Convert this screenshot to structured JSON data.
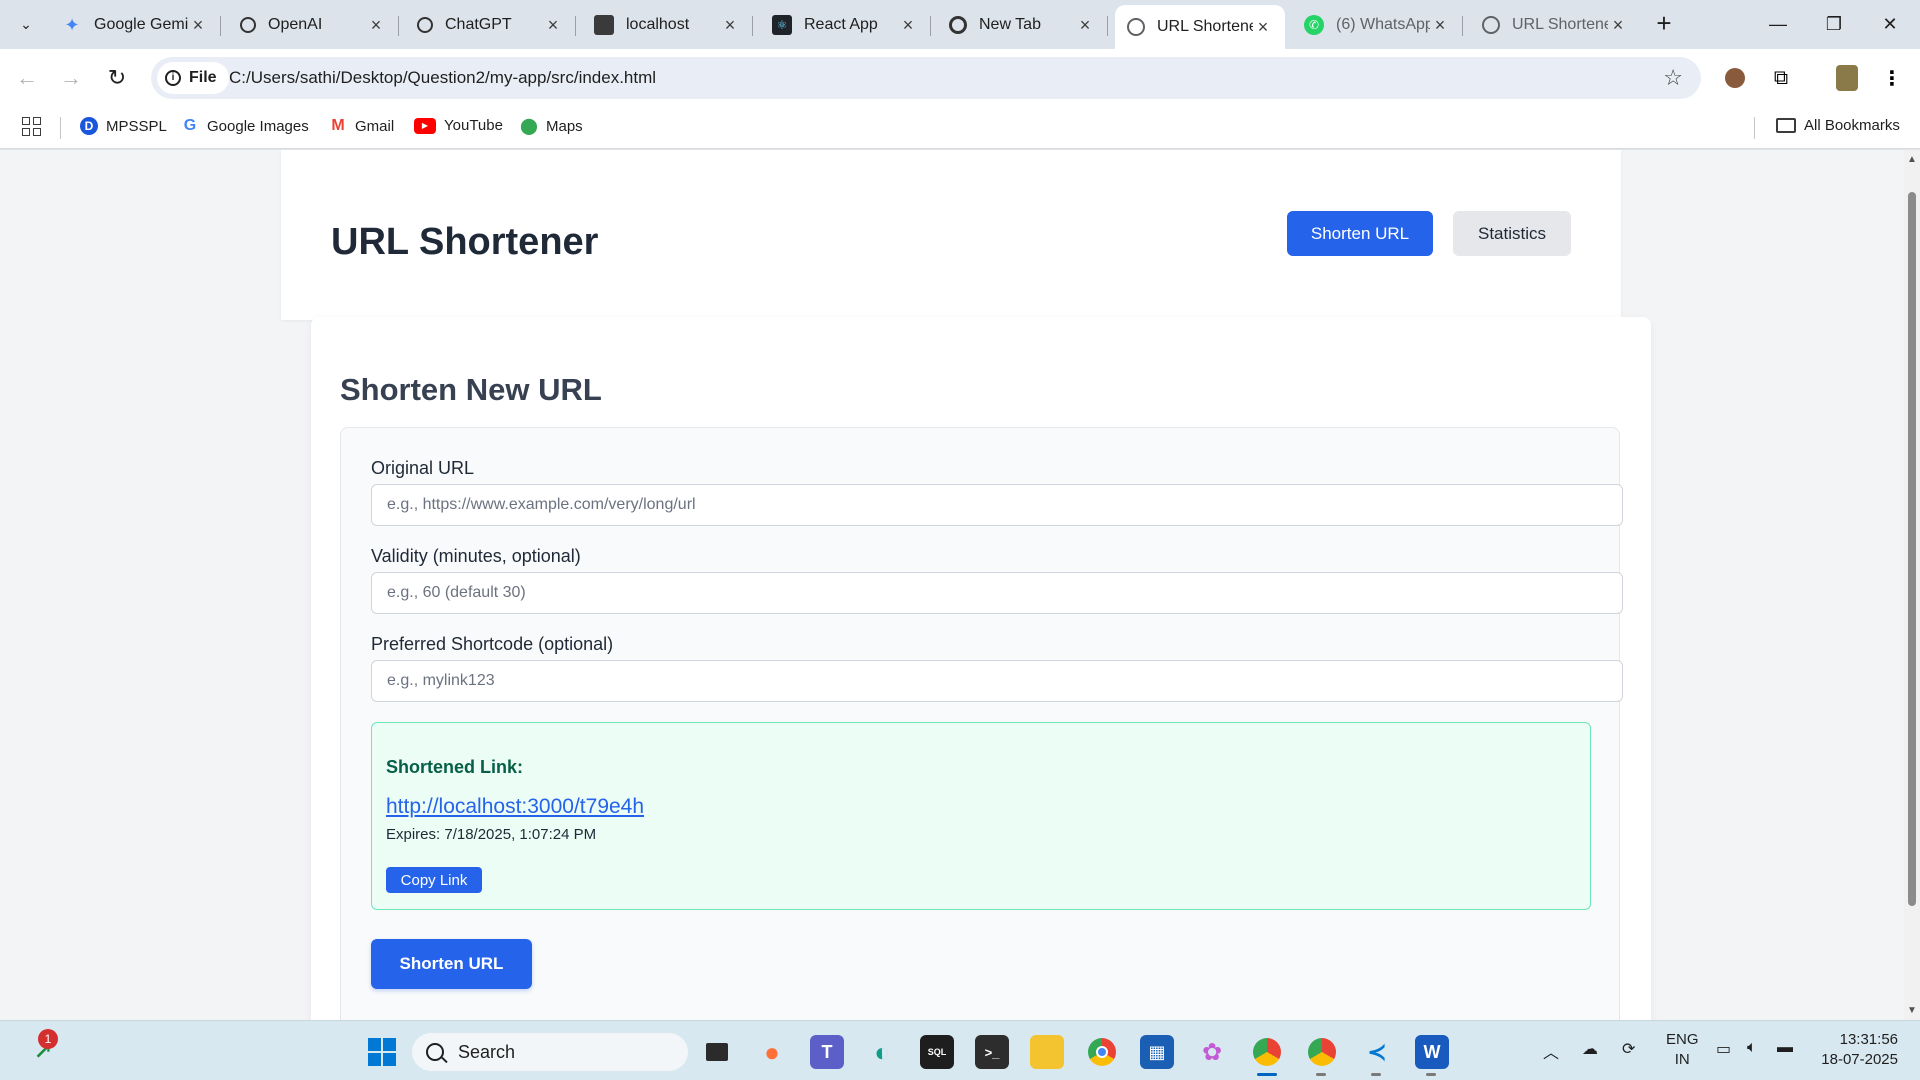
{
  "browser": {
    "tabs": [
      {
        "title": "Google Gemi",
        "active": false
      },
      {
        "title": "OpenAI",
        "active": false
      },
      {
        "title": "ChatGPT",
        "active": false
      },
      {
        "title": "localhost",
        "active": false
      },
      {
        "title": "React App",
        "active": false
      },
      {
        "title": "New Tab",
        "active": false
      },
      {
        "title": "URL Shortene",
        "active": true
      },
      {
        "title": "(6) WhatsApp",
        "active": false
      },
      {
        "title": "URL Shortene",
        "active": false
      }
    ],
    "address": {
      "chip_label": "File",
      "url": "C:/Users/sathi/Desktop/Question2/my-app/src/index.html"
    },
    "bookmarks": [
      "MPSSPL",
      "Google Images",
      "Gmail",
      "YouTube",
      "Maps"
    ],
    "all_bookmarks_label": "All Bookmarks"
  },
  "app": {
    "title": "URL Shortener",
    "nav": {
      "shorten": "Shorten URL",
      "stats": "Statistics"
    },
    "section_title": "Shorten New URL",
    "form": {
      "original_url": {
        "label": "Original URL",
        "placeholder": "e.g., https://www.example.com/very/long/url",
        "value": ""
      },
      "validity": {
        "label": "Validity (minutes, optional)",
        "placeholder": "e.g., 60 (default 30)",
        "value": ""
      },
      "shortcode": {
        "label": "Preferred Shortcode (optional)",
        "placeholder": "e.g., mylink123",
        "value": ""
      }
    },
    "result": {
      "title": "Shortened Link:",
      "link": "http://localhost:3000/t79e4h",
      "expires": "Expires: 7/18/2025, 1:07:24 PM",
      "copy_label": "Copy Link"
    },
    "submit_label": "Shorten URL"
  },
  "taskbar": {
    "search_label": "Search",
    "badge_count": "1",
    "language": {
      "line1": "ENG",
      "line2": "IN"
    },
    "time": "13:31:56",
    "date": "18-07-2025"
  },
  "colors": {
    "primary": "#2563eb",
    "success_bg": "#ecfdf5",
    "success_border": "#6ee7b7",
    "page_bg": "#f3f4f6"
  }
}
